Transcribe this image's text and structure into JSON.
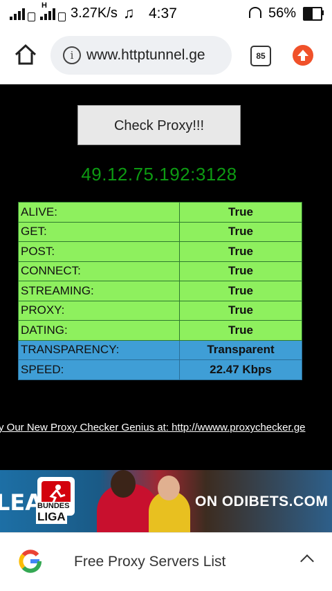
{
  "status_bar": {
    "net1": "H",
    "data_rate": "3.27K/s",
    "time": "4:37",
    "battery": "56%"
  },
  "browser": {
    "url": "www.httptunnel.ge",
    "tab_count": "85"
  },
  "main": {
    "check_button": "Check Proxy!!!",
    "proxy_address": "49.12.75.192:3128",
    "rows": [
      {
        "label": "ALIVE:",
        "value": "True"
      },
      {
        "label": "GET:",
        "value": "True"
      },
      {
        "label": "POST:",
        "value": "True"
      },
      {
        "label": "CONNECT:",
        "value": "True"
      },
      {
        "label": "STREAMING:",
        "value": "True"
      },
      {
        "label": "PROXY:",
        "value": "True"
      },
      {
        "label": "DATING:",
        "value": "True"
      },
      {
        "label": "TRANSPARENCY:",
        "value": "Transparent"
      },
      {
        "label": "SPEED:",
        "value": "22.47 Kbps"
      }
    ],
    "promo_link": "y Our New Proxy Checker Genius at: http://wwww.proxychecker.ge"
  },
  "ad": {
    "left_text": "LEA",
    "logo_line1": "BUNDES",
    "logo_line2": "LIGA",
    "right_text": "ON ODIBETS.COM"
  },
  "bottom_sheet": {
    "title": "Free Proxy Servers List"
  },
  "colors": {
    "green_row": "#8ef05e",
    "blue_row": "#3f9ed6",
    "proxy_text": "#0d9a12"
  }
}
